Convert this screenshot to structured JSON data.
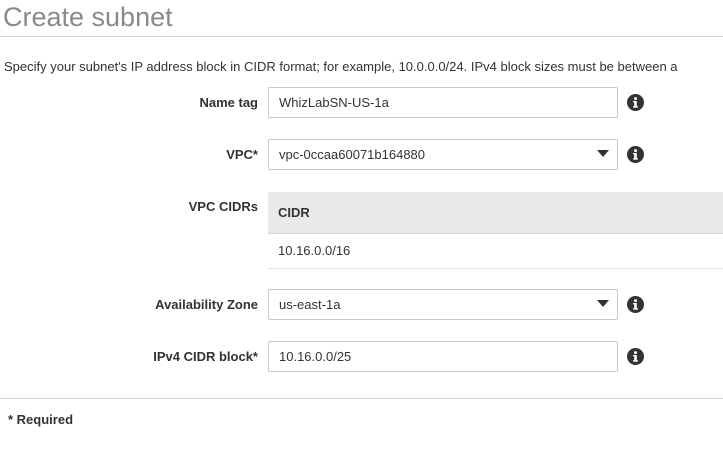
{
  "page": {
    "title": "Create subnet",
    "description": "Specify your subnet's IP address block in CIDR format; for example, 10.0.0.0/24. IPv4 block sizes must be between a"
  },
  "form": {
    "name_tag": {
      "label": "Name tag",
      "value": "WhizLabSN-US-1a"
    },
    "vpc": {
      "label": "VPC*",
      "value": "vpc-0ccaa60071b164880"
    },
    "vpc_cidrs": {
      "label": "VPC CIDRs",
      "column_header": "CIDR",
      "rows": [
        "10.16.0.0/16"
      ]
    },
    "availability_zone": {
      "label": "Availability Zone",
      "value": "us-east-1a"
    },
    "ipv4_cidr_block": {
      "label": "IPv4 CIDR block*",
      "value": "10.16.0.0/25"
    }
  },
  "footer": {
    "required_note": "* Required"
  },
  "icons": {
    "info": "info-icon",
    "dropdown": "caret-down-icon"
  },
  "colors": {
    "title": "#8a8a8a",
    "text": "#333333",
    "input_border": "#c9c9c9",
    "table_header_bg": "#e9e9e9",
    "rule": "#d5d5d5"
  }
}
